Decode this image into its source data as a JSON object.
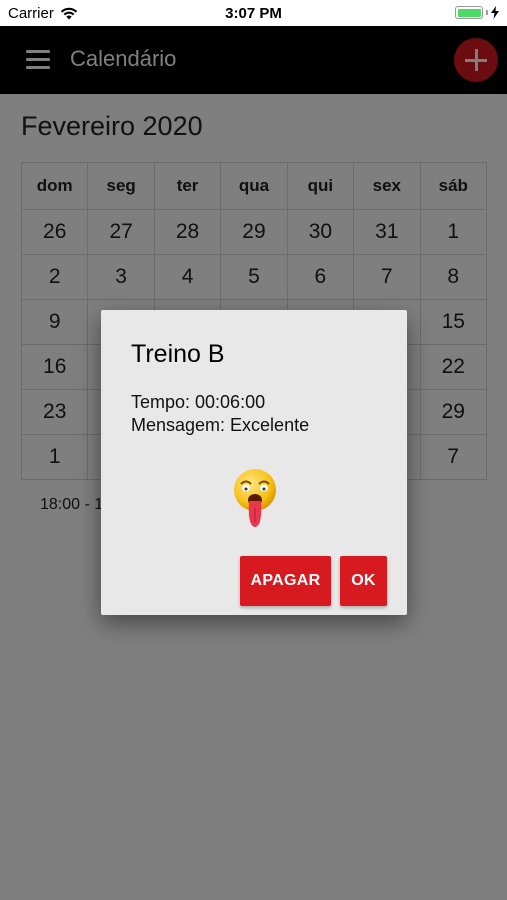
{
  "status_bar": {
    "carrier": "Carrier",
    "time": "3:07 PM"
  },
  "app_bar": {
    "title": "Calendário",
    "menu_icon": "hamburger-menu-icon",
    "add_icon": "plus-icon"
  },
  "calendar": {
    "month_title": "Fevereiro 2020",
    "weekdays": [
      "dom",
      "seg",
      "ter",
      "qua",
      "qui",
      "sex",
      "sáb"
    ],
    "weeks": [
      [
        "26",
        "27",
        "28",
        "29",
        "30",
        "31",
        "1"
      ],
      [
        "2",
        "3",
        "4",
        "5",
        "6",
        "7",
        "8"
      ],
      [
        "9",
        "",
        "",
        "",
        "",
        "",
        "15"
      ],
      [
        "16",
        "",
        "",
        "",
        "",
        "",
        "22"
      ],
      [
        "23",
        "",
        "",
        "",
        "",
        "",
        "29"
      ],
      [
        "1",
        "",
        "",
        "",
        "",
        "",
        "7"
      ]
    ],
    "event_preview": "18:00 - 1"
  },
  "dialog": {
    "title": "Treino B",
    "time_line": "Tempo: 00:06:00",
    "message_line": "Mensagem: Excelente",
    "emoji_icon": "exhausted-face-emoji-icon",
    "delete_label": "APAGAR",
    "ok_label": "OK"
  },
  "colors": {
    "app_bar": "#000000",
    "accent": "#d71920",
    "dialog_bg": "#e8e8e8",
    "scrim": "rgba(0,0,0,0.5)"
  }
}
